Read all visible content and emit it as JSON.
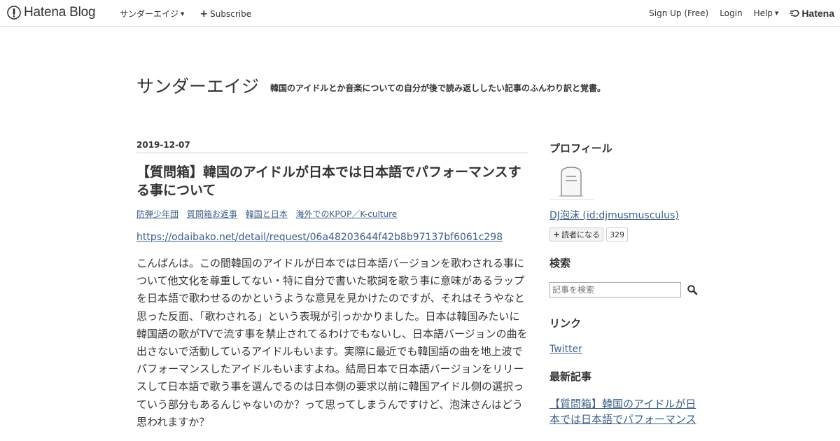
{
  "topbar": {
    "brand": "Hatena Blog",
    "blog_menu": "サンダーエイジ",
    "subscribe": "Subscribe",
    "signup": "Sign Up (Free)",
    "login": "Login",
    "help": "Help",
    "hatena": "Hatena"
  },
  "header": {
    "title": "サンダーエイジ",
    "description": "韓国のアイドルとか音楽についての自分が後で読み返ししたい記事のふんわり訳と覚書。"
  },
  "entry": {
    "date": "2019-12-07",
    "title": "【質問箱】韓国のアイドルが日本では日本語でパフォーマンスする事について",
    "categories": [
      "防弾少年団",
      "質問箱お返事",
      "韓国と日本",
      "海外でのKPOP／K-culture"
    ],
    "link": "https://odaibako.net/detail/request/06a48203644f42b8b97137bf6061c298",
    "body": "こんばんは。この間韓国のアイドルが日本では日本語バージョンを歌わされる事について他文化を尊重してない・特に自分で書いた歌詞を歌う事に意味があるラップを日本語で歌わせるのかというような意見を見かけたのですが、それはそうやなと思った反面、「歌わされる」という表現が引っかかりました。日本は韓国みたいに韓国語の歌がTVで流す事を禁止されてるわけでもないし、日本語バージョンの曲を出さないで活動しているアイドルもいます。実際に最近でも韓国語の曲を地上波でパフォーマンスしたアイドルもいますよね。結局日本で日本語バージョンをリリースして日本語で歌う事を選んでるのは日本側の要求以前に韓国アイドル側の選択っていう部分もあるんじゃないのか？って思ってしまうんですけど、泡沫さんはどう思われますか？"
  },
  "sidebar": {
    "profile_title": "プロフィール",
    "profile_name": "DJ泡沫 (id:djmusmusculus)",
    "reader_button": "読者になる",
    "reader_count": "329",
    "search_title": "検索",
    "search_placeholder": "記事を検索",
    "link_title": "リンク",
    "twitter": "Twitter",
    "recent_title": "最新記事",
    "recent_entry": "【質問箱】韓国のアイドルが日本では日本語でパフォーマンス"
  },
  "colors": {
    "link": "#3b5e86",
    "text": "#333333",
    "border": "#dddddd"
  }
}
